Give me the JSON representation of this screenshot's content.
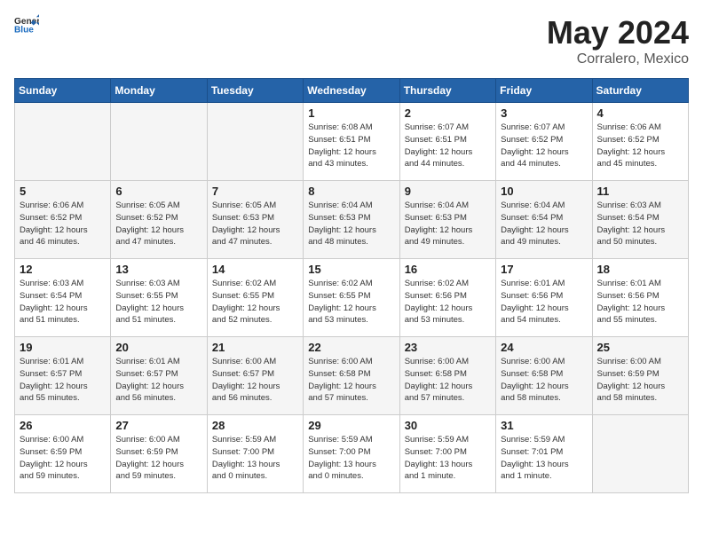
{
  "header": {
    "logo_general": "General",
    "logo_blue": "Blue",
    "title": "May 2024",
    "location": "Corralero, Mexico"
  },
  "days_of_week": [
    "Sunday",
    "Monday",
    "Tuesday",
    "Wednesday",
    "Thursday",
    "Friday",
    "Saturday"
  ],
  "weeks": [
    [
      {
        "day": "",
        "info": ""
      },
      {
        "day": "",
        "info": ""
      },
      {
        "day": "",
        "info": ""
      },
      {
        "day": "1",
        "info": "Sunrise: 6:08 AM\nSunset: 6:51 PM\nDaylight: 12 hours\nand 43 minutes."
      },
      {
        "day": "2",
        "info": "Sunrise: 6:07 AM\nSunset: 6:51 PM\nDaylight: 12 hours\nand 44 minutes."
      },
      {
        "day": "3",
        "info": "Sunrise: 6:07 AM\nSunset: 6:52 PM\nDaylight: 12 hours\nand 44 minutes."
      },
      {
        "day": "4",
        "info": "Sunrise: 6:06 AM\nSunset: 6:52 PM\nDaylight: 12 hours\nand 45 minutes."
      }
    ],
    [
      {
        "day": "5",
        "info": "Sunrise: 6:06 AM\nSunset: 6:52 PM\nDaylight: 12 hours\nand 46 minutes."
      },
      {
        "day": "6",
        "info": "Sunrise: 6:05 AM\nSunset: 6:52 PM\nDaylight: 12 hours\nand 47 minutes."
      },
      {
        "day": "7",
        "info": "Sunrise: 6:05 AM\nSunset: 6:53 PM\nDaylight: 12 hours\nand 47 minutes."
      },
      {
        "day": "8",
        "info": "Sunrise: 6:04 AM\nSunset: 6:53 PM\nDaylight: 12 hours\nand 48 minutes."
      },
      {
        "day": "9",
        "info": "Sunrise: 6:04 AM\nSunset: 6:53 PM\nDaylight: 12 hours\nand 49 minutes."
      },
      {
        "day": "10",
        "info": "Sunrise: 6:04 AM\nSunset: 6:54 PM\nDaylight: 12 hours\nand 49 minutes."
      },
      {
        "day": "11",
        "info": "Sunrise: 6:03 AM\nSunset: 6:54 PM\nDaylight: 12 hours\nand 50 minutes."
      }
    ],
    [
      {
        "day": "12",
        "info": "Sunrise: 6:03 AM\nSunset: 6:54 PM\nDaylight: 12 hours\nand 51 minutes."
      },
      {
        "day": "13",
        "info": "Sunrise: 6:03 AM\nSunset: 6:55 PM\nDaylight: 12 hours\nand 51 minutes."
      },
      {
        "day": "14",
        "info": "Sunrise: 6:02 AM\nSunset: 6:55 PM\nDaylight: 12 hours\nand 52 minutes."
      },
      {
        "day": "15",
        "info": "Sunrise: 6:02 AM\nSunset: 6:55 PM\nDaylight: 12 hours\nand 53 minutes."
      },
      {
        "day": "16",
        "info": "Sunrise: 6:02 AM\nSunset: 6:56 PM\nDaylight: 12 hours\nand 53 minutes."
      },
      {
        "day": "17",
        "info": "Sunrise: 6:01 AM\nSunset: 6:56 PM\nDaylight: 12 hours\nand 54 minutes."
      },
      {
        "day": "18",
        "info": "Sunrise: 6:01 AM\nSunset: 6:56 PM\nDaylight: 12 hours\nand 55 minutes."
      }
    ],
    [
      {
        "day": "19",
        "info": "Sunrise: 6:01 AM\nSunset: 6:57 PM\nDaylight: 12 hours\nand 55 minutes."
      },
      {
        "day": "20",
        "info": "Sunrise: 6:01 AM\nSunset: 6:57 PM\nDaylight: 12 hours\nand 56 minutes."
      },
      {
        "day": "21",
        "info": "Sunrise: 6:00 AM\nSunset: 6:57 PM\nDaylight: 12 hours\nand 56 minutes."
      },
      {
        "day": "22",
        "info": "Sunrise: 6:00 AM\nSunset: 6:58 PM\nDaylight: 12 hours\nand 57 minutes."
      },
      {
        "day": "23",
        "info": "Sunrise: 6:00 AM\nSunset: 6:58 PM\nDaylight: 12 hours\nand 57 minutes."
      },
      {
        "day": "24",
        "info": "Sunrise: 6:00 AM\nSunset: 6:58 PM\nDaylight: 12 hours\nand 58 minutes."
      },
      {
        "day": "25",
        "info": "Sunrise: 6:00 AM\nSunset: 6:59 PM\nDaylight: 12 hours\nand 58 minutes."
      }
    ],
    [
      {
        "day": "26",
        "info": "Sunrise: 6:00 AM\nSunset: 6:59 PM\nDaylight: 12 hours\nand 59 minutes."
      },
      {
        "day": "27",
        "info": "Sunrise: 6:00 AM\nSunset: 6:59 PM\nDaylight: 12 hours\nand 59 minutes."
      },
      {
        "day": "28",
        "info": "Sunrise: 5:59 AM\nSunset: 7:00 PM\nDaylight: 13 hours\nand 0 minutes."
      },
      {
        "day": "29",
        "info": "Sunrise: 5:59 AM\nSunset: 7:00 PM\nDaylight: 13 hours\nand 0 minutes."
      },
      {
        "day": "30",
        "info": "Sunrise: 5:59 AM\nSunset: 7:00 PM\nDaylight: 13 hours\nand 1 minute."
      },
      {
        "day": "31",
        "info": "Sunrise: 5:59 AM\nSunset: 7:01 PM\nDaylight: 13 hours\nand 1 minute."
      },
      {
        "day": "",
        "info": ""
      }
    ]
  ]
}
